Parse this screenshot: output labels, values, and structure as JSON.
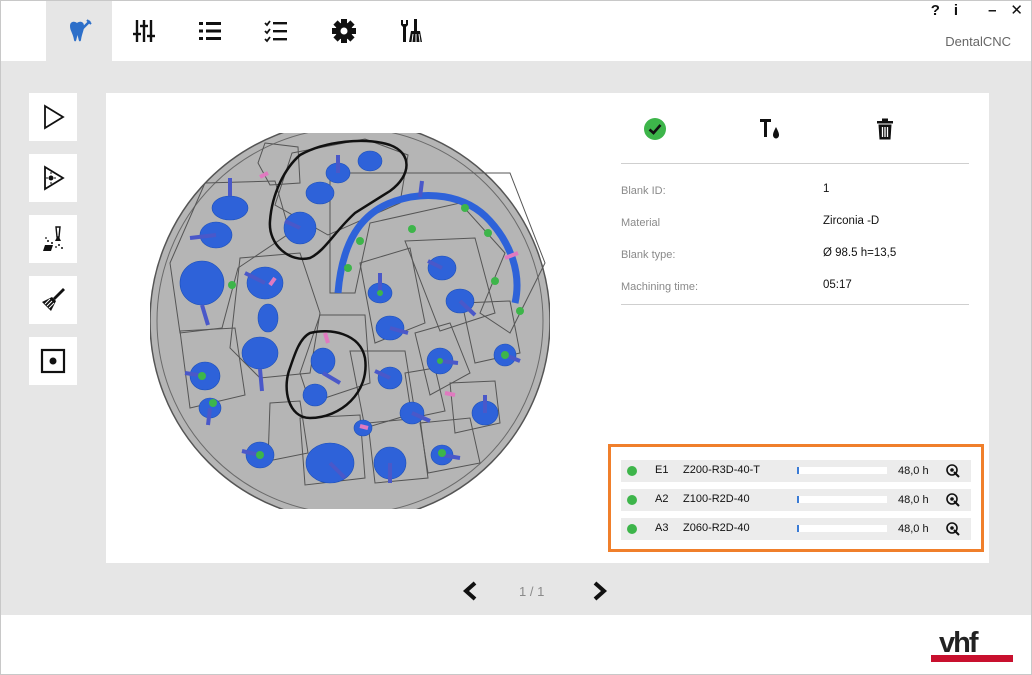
{
  "app": {
    "name": "DentalCNC",
    "window_controls": {
      "help": "?",
      "info": "i",
      "minimize": "–",
      "close": "✕"
    }
  },
  "topnav": {
    "items": [
      {
        "icon": "tooth-tool-icon",
        "active": true
      },
      {
        "icon": "sliders-icon",
        "active": false
      },
      {
        "icon": "list-icon",
        "active": false
      },
      {
        "icon": "checklist-icon",
        "active": false
      },
      {
        "icon": "gear-icon",
        "active": false
      },
      {
        "icon": "tools-icon",
        "active": false
      }
    ]
  },
  "sidebar": {
    "items": [
      {
        "icon": "play-icon"
      },
      {
        "icon": "play-laser-icon"
      },
      {
        "icon": "clean-spray-icon"
      },
      {
        "icon": "brush-icon"
      },
      {
        "icon": "center-target-icon"
      }
    ]
  },
  "actions": [
    {
      "icon": "check-circle-icon",
      "color": "#3db54a"
    },
    {
      "icon": "tool-water-icon"
    },
    {
      "icon": "trash-icon"
    }
  ],
  "blank_info": {
    "rows": [
      {
        "label": "Blank ID:",
        "value": "1"
      },
      {
        "label": "Material",
        "value": "Zirconia -D"
      },
      {
        "label": "Blank type:",
        "value": "Ø 98.5  h=13,5"
      },
      {
        "label": "Machining time:",
        "value": "05:17"
      }
    ]
  },
  "tools": [
    {
      "slot": "E1",
      "name": "Z200-R3D-40-T",
      "life": "48,0 h",
      "status_color": "#3db54a",
      "fill_fraction": 0.02
    },
    {
      "slot": "A2",
      "name": "Z100-R2D-40",
      "life": "48,0 h",
      "status_color": "#3db54a",
      "fill_fraction": 0.02
    },
    {
      "slot": "A3",
      "name": "Z060-R2D-40",
      "life": "48,0 h",
      "status_color": "#3db54a",
      "fill_fraction": 0.02
    }
  ],
  "pager": {
    "text": "1 / 1"
  },
  "brand": {
    "logo_text": "vhf",
    "accent": "#c8102e",
    "highlight": "#f07f2b"
  }
}
